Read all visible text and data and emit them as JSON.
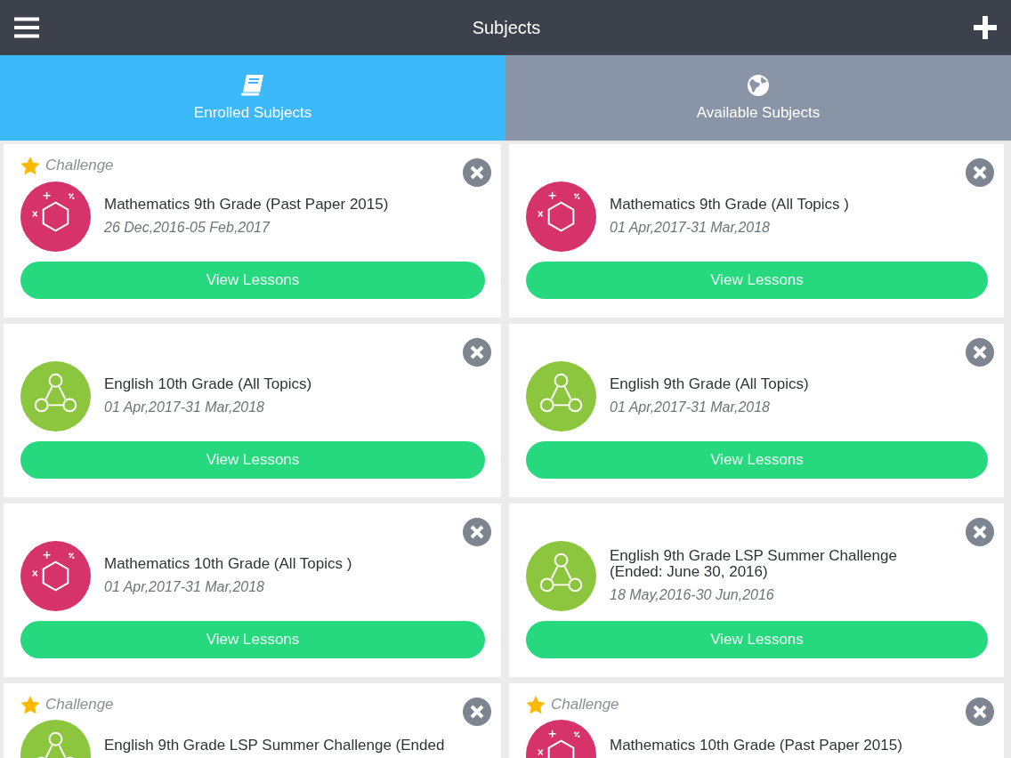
{
  "header": {
    "title": "Subjects"
  },
  "tabs": [
    {
      "label": "Enrolled Subjects",
      "selected": true
    },
    {
      "label": "Available Subjects",
      "selected": false
    }
  ],
  "subjects": [
    {
      "challenge": "Challenge",
      "title": "Mathematics 9th Grade (Past Paper 2015)",
      "dates": "26 Dec,2016-05 Feb,2017",
      "kind": "math",
      "button": "View Lessons"
    },
    {
      "title": "Mathematics 9th Grade (All Topics )",
      "dates": "01 Apr,2017-31 Mar,2018",
      "kind": "math",
      "button": "View Lessons"
    },
    {
      "title": "English 10th Grade (All Topics)",
      "dates": "01 Apr,2017-31 Mar,2018",
      "kind": "english",
      "button": "View Lessons"
    },
    {
      "title": "English 9th Grade (All Topics)",
      "dates": "01 Apr,2017-31 Mar,2018",
      "kind": "english",
      "button": "View Lessons"
    },
    {
      "title": "Mathematics 10th Grade (All Topics )",
      "dates": "01 Apr,2017-31 Mar,2018",
      "kind": "math",
      "button": "View Lessons"
    },
    {
      "title": "English 9th Grade LSP Summer Challenge (Ended: June 30, 2016)",
      "dates": "18 May,2016-30 Jun,2016",
      "kind": "english",
      "button": "View Lessons"
    },
    {
      "challenge": "Challenge",
      "title": "English 9th Grade LSP Summer Challenge (Ended",
      "kind": "english"
    },
    {
      "challenge": "Challenge",
      "title": "Mathematics 10th Grade (Past Paper 2015)",
      "kind": "math"
    }
  ]
}
